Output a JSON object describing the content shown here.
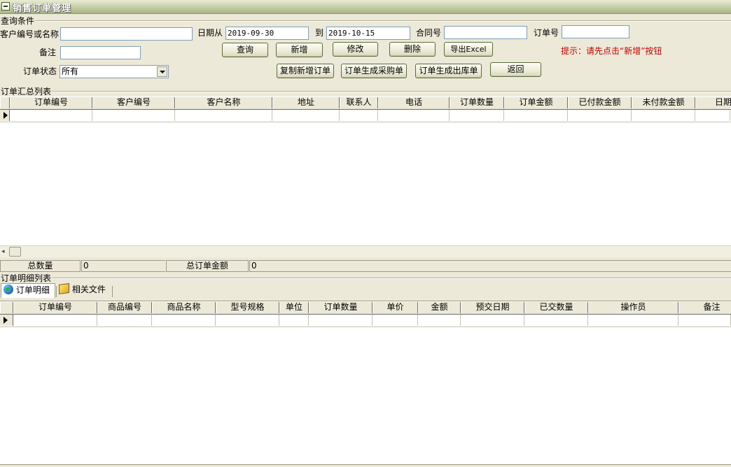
{
  "window": {
    "title": "销售订单管理"
  },
  "query": {
    "group_label": "查询条件",
    "customer_label": "客户编号或名称",
    "customer_value": "",
    "date_from_label": "日期从",
    "date_from_value": "2019-09-30",
    "date_to_label": "到",
    "date_to_value": "2019-10-15",
    "contract_label": "合同号",
    "contract_value": "",
    "order_no_label": "订单号",
    "order_no_value": "",
    "remark_label": "备注",
    "remark_value": "",
    "status_label": "订单状态",
    "status_value": "所有",
    "hint": "提示：请先点击“新增”按钮"
  },
  "buttons": {
    "query": "查询",
    "add": "新增",
    "edit": "修改",
    "delete": "删除",
    "export": "导出Excel",
    "copy_new": "复制新增订单",
    "gen_purchase": "订单生成采购单",
    "gen_outbound": "订单生成出库单",
    "back": "返回"
  },
  "summary_list": {
    "group_label": "订单汇总列表",
    "columns": [
      "订单编号",
      "客户编号",
      "客户名称",
      "地址",
      "联系人",
      "电话",
      "订单数量",
      "订单金额",
      "已付款金额",
      "未付款金额",
      "日期"
    ]
  },
  "totals": {
    "qty_label": "总数量",
    "qty_value": "0",
    "amount_label": "总订单金额",
    "amount_value": "0"
  },
  "detail_list": {
    "group_label": "订单明细列表",
    "tabs": [
      "订单明细",
      "相关文件"
    ],
    "columns": [
      "订单编号",
      "商品编号",
      "商品名称",
      "型号规格",
      "单位",
      "订单数量",
      "单价",
      "金额",
      "预交日期",
      "已交数量",
      "操作员",
      "备注"
    ]
  },
  "icons": {
    "window": "form-icon",
    "tab_detail": "globe-icon",
    "tab_files": "box-icon"
  }
}
